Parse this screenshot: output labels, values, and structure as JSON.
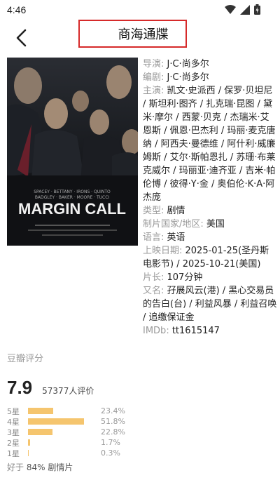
{
  "status": {
    "time": "4:46"
  },
  "header": {
    "title": "商海通牒"
  },
  "poster": {
    "alt_text": "MARGIN CALL"
  },
  "info": [
    {
      "label": "导演: ",
      "value": "J·C·尚多尔"
    },
    {
      "label": "编剧: ",
      "value": "J·C·尚多尔"
    },
    {
      "label": "主演: ",
      "value": "凯文·史派西 / 保罗·贝坦尼 / 斯坦利·图齐 / 扎克瑞·昆图 / 黛米·摩尔 / 西蒙·贝克 / 杰瑞米·艾恩斯 / 佩恩·巴杰利 / 玛丽·麦克唐纳 / 阿西夫·曼德维 / 阿什利·威廉姆斯 / 艾尔·斯帕恩扎 / 苏珊·布莱克威尔 / 玛丽亚·迪齐亚 / 吉米·帕伦博 / 彼得·Y·金 / 奥伯伦·K·A·阿杰庞"
    },
    {
      "label": "类型: ",
      "value": "剧情"
    },
    {
      "label": "制片国家/地区: ",
      "value": "美国"
    },
    {
      "label": "语言: ",
      "value": "英语"
    },
    {
      "label": "上映日期: ",
      "value": "2025-01-25(圣丹斯电影节) / 2025-10-21(美国)"
    },
    {
      "label": "片长: ",
      "value": "107分钟"
    },
    {
      "label": "又名: ",
      "value": "孖展风云(港) / 黑心交易员的告白(台) / 利益风暴 / 利益召唤 / 追缴保证金"
    },
    {
      "label": "IMDb: ",
      "value": "tt1615147"
    }
  ],
  "rating": {
    "title": "豆瓣评分",
    "score": "7.9",
    "count": "57377人评价",
    "stars": [
      {
        "label": "5星",
        "percent": 23.4,
        "text": "23.4%"
      },
      {
        "label": "4星",
        "percent": 51.8,
        "text": "51.8%"
      },
      {
        "label": "3星",
        "percent": 22.8,
        "text": "22.8%"
      },
      {
        "label": "2星",
        "percent": 1.7,
        "text": "1.7%"
      },
      {
        "label": "1星",
        "percent": 0.3,
        "text": "0.3%"
      }
    ],
    "better_prefix": "好于",
    "better_value": "84%",
    "better_suffix": "剧情片"
  },
  "colors": {
    "bar": "#f5c56e",
    "highlight_border": "#d62a2a",
    "label": "#999999"
  }
}
